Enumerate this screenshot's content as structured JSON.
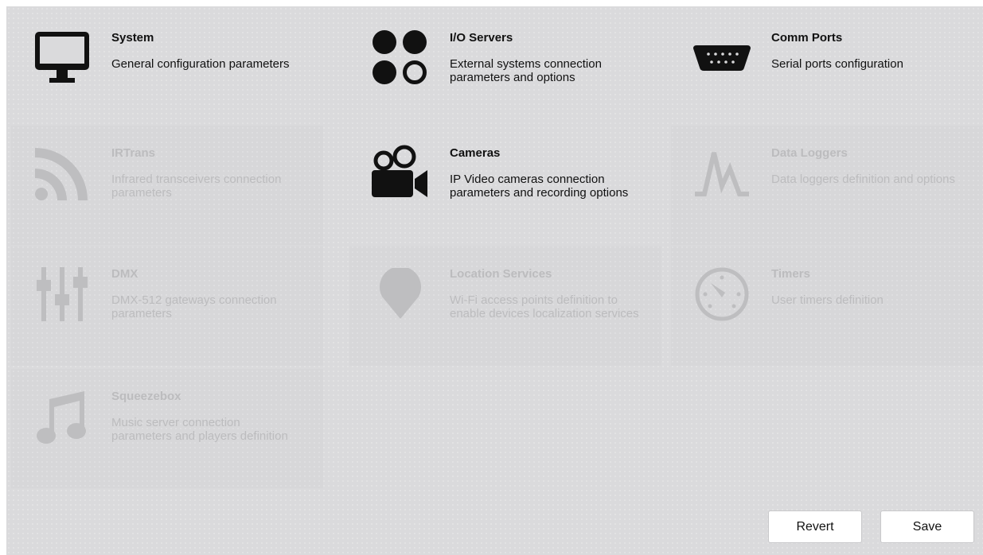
{
  "tiles": [
    {
      "key": "system",
      "title": "System",
      "description": "General configuration parameters",
      "enabled": true,
      "icon": "monitor-icon"
    },
    {
      "key": "io-servers",
      "title": "I/O Servers",
      "description": "External systems connection parameters and options",
      "enabled": true,
      "icon": "circles-icon"
    },
    {
      "key": "comm-ports",
      "title": "Comm Ports",
      "description": "Serial ports configuration",
      "enabled": true,
      "icon": "serial-port-icon"
    },
    {
      "key": "irtrans",
      "title": "IRTrans",
      "description": "Infrared transceivers connection parameters",
      "enabled": false,
      "icon": "signal-waves-icon"
    },
    {
      "key": "cameras",
      "title": "Cameras",
      "description": "IP Video cameras connection parameters and recording options",
      "enabled": true,
      "icon": "video-camera-icon"
    },
    {
      "key": "data-loggers",
      "title": "Data Loggers",
      "description": "Data loggers definition and options",
      "enabled": false,
      "icon": "peaks-icon"
    },
    {
      "key": "dmx",
      "title": "DMX",
      "description": "DMX-512 gateways connection parameters",
      "enabled": false,
      "icon": "sliders-icon"
    },
    {
      "key": "location-services",
      "title": "Location Services",
      "description": "Wi-Fi access points definition to enable devices localization services",
      "enabled": false,
      "icon": "location-pin-icon"
    },
    {
      "key": "timers",
      "title": "Timers",
      "description": "User timers definition",
      "enabled": false,
      "icon": "gauge-icon"
    },
    {
      "key": "squeezebox",
      "title": "Squeezebox",
      "description": "Music server connection parameters and players definition",
      "enabled": false,
      "icon": "music-note-icon"
    }
  ],
  "buttons": {
    "revert_label": "Revert",
    "save_label": "Save"
  },
  "colors": {
    "background": "#dadadc",
    "enabled_text": "#111111",
    "disabled_text": "#bcbcbe",
    "button_background": "#ffffff"
  }
}
